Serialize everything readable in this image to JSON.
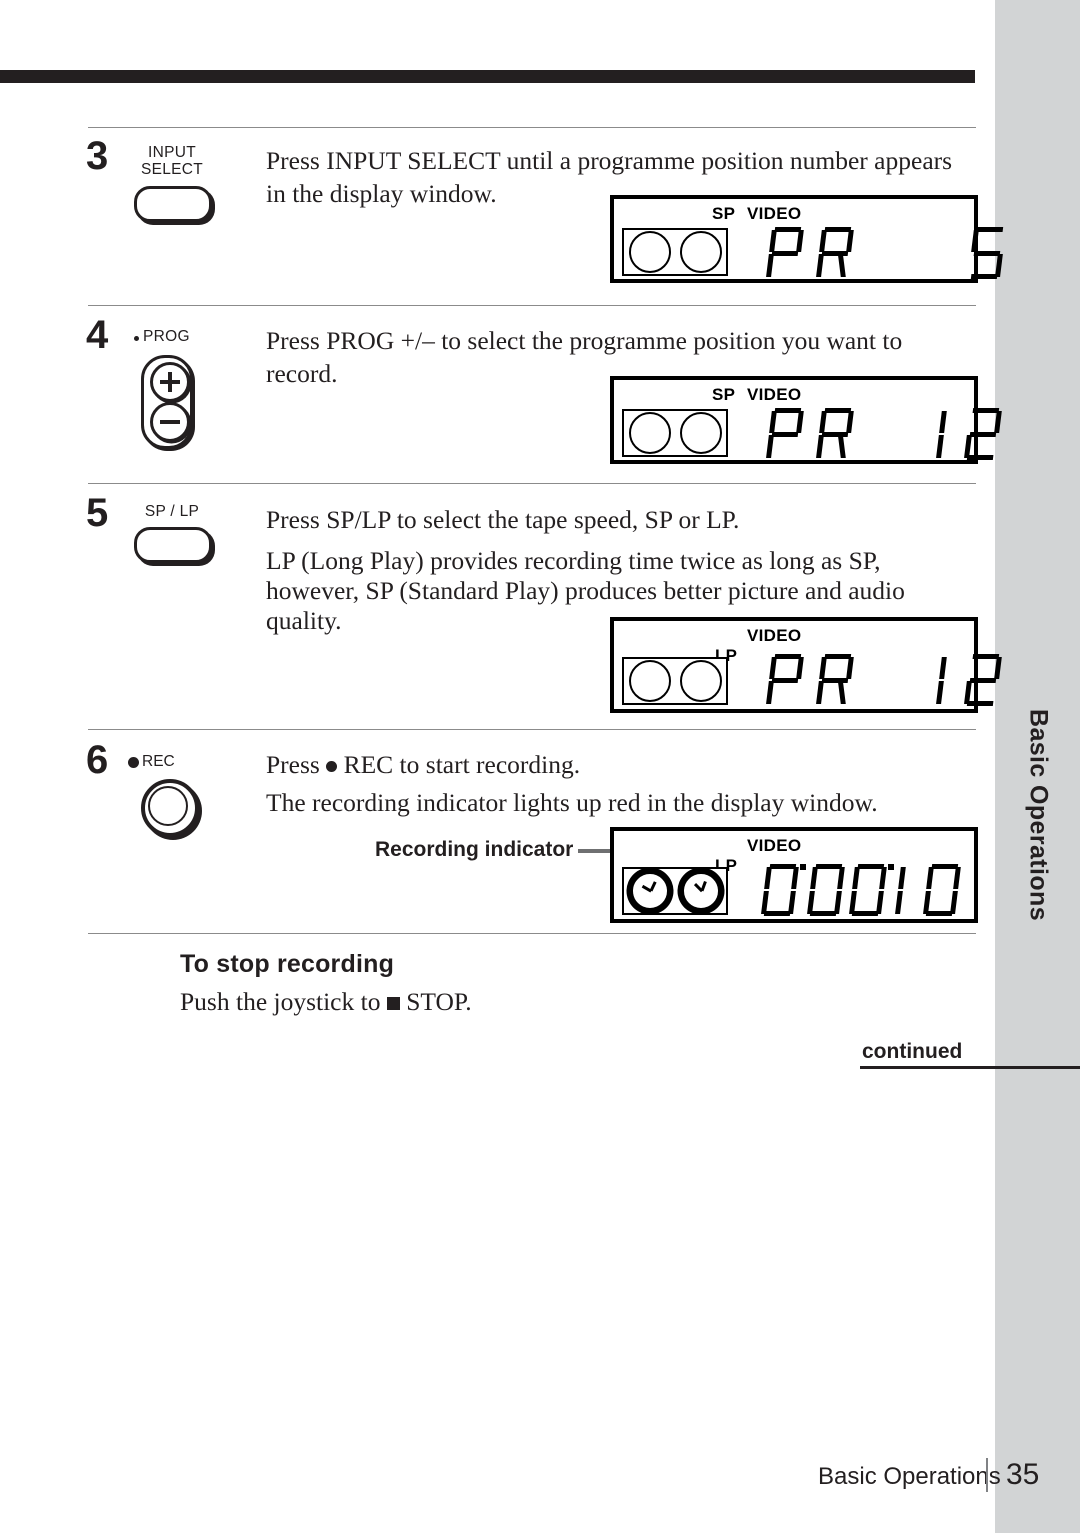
{
  "page": {
    "chapter_tab": "Basic Operations",
    "footer_chapter": "Basic Operations",
    "footer_page_number": "35",
    "continued_label": "continued"
  },
  "steps": [
    {
      "number": "3",
      "button_label": "INPUT\nSELECT",
      "button_type": "pill-button",
      "lines": [
        "Press INPUT SELECT until a programme position number appears",
        "in the display window."
      ]
    },
    {
      "number": "4",
      "button_label": "PROG",
      "button_type": "prog-plus-minus-button",
      "lines": [
        "Press PROG +/– to select the programme position you want to",
        "record."
      ]
    },
    {
      "number": "5",
      "button_label": "SP / LP",
      "button_type": "pill-button",
      "lines": [
        "Press SP/LP to select the tape speed, SP or LP.",
        "LP (Long Play) provides recording time twice as long as SP,",
        "however, SP (Standard Play) produces better picture and audio",
        "quality."
      ]
    },
    {
      "number": "6",
      "button_label": "REC",
      "button_type": "rec-round-button",
      "lines": [
        "Press ● REC to start recording.",
        "The recording indicator lights up red in the display window."
      ],
      "line1_before_dot": "Press ",
      "line1_after_dot": " REC to start recording.",
      "line2": "The recording indicator lights up red in the display window."
    }
  ],
  "displays": [
    {
      "id": "display-step-3",
      "indicators": [
        "SP",
        "VIDEO"
      ],
      "reels_recording": false,
      "segment_text": "PR 5",
      "segment_left": "PR",
      "segment_right": "5"
    },
    {
      "id": "display-step-4",
      "indicators": [
        "SP",
        "VIDEO"
      ],
      "reels_recording": false,
      "segment_text": "PR 12",
      "segment_left": "PR",
      "segment_right": "12"
    },
    {
      "id": "display-step-5",
      "indicators": [
        "LP",
        "VIDEO"
      ],
      "reels_recording": false,
      "segment_text": "PR 12",
      "segment_left": "PR",
      "segment_right": "12"
    },
    {
      "id": "display-step-6",
      "indicators": [
        "LP",
        "VIDEO"
      ],
      "reels_recording": true,
      "segment_text": "0:00:10",
      "callout": "Recording indicator"
    }
  ],
  "stop_section": {
    "heading": "To stop recording",
    "text_before_square": "Push the joystick to ",
    "text_after_square": " STOP.",
    "text_full": "Push the joystick to ■ STOP."
  },
  "colors": {
    "ink": "#231f20",
    "tab_gray": "#d2d4d5",
    "rule_gray": "#8b8b8b",
    "callout_gray": "#6f7071"
  }
}
